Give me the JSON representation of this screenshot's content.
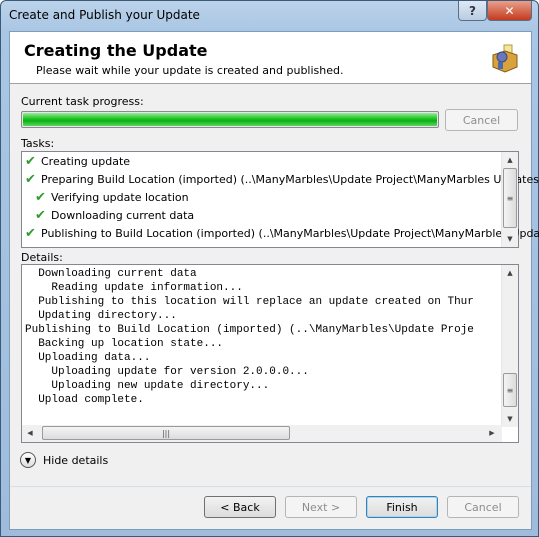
{
  "window": {
    "title": "Create and Publish your Update",
    "help_label": "?",
    "close_label": "✕"
  },
  "header": {
    "title": "Creating the Update",
    "subtitle": "Please wait while your update is created and published.",
    "logo_icon": "package-gear-icon"
  },
  "progress": {
    "label": "Current task progress:",
    "percent": 100,
    "cancel_label": "Cancel",
    "bar_color": "#16c41e"
  },
  "tasks": {
    "label": "Tasks:",
    "items": [
      {
        "text": "Creating update",
        "level": 0,
        "status": "done"
      },
      {
        "text": "Preparing Build Location (imported) (..\\ManyMarbles\\Update Project\\ManyMarbles Updates)",
        "level": 0,
        "status": "done"
      },
      {
        "text": "Verifying update location",
        "level": 1,
        "status": "done"
      },
      {
        "text": "Downloading current data",
        "level": 1,
        "status": "done"
      },
      {
        "text": "Publishing to Build Location (imported) (..\\ManyMarbles\\Update Project\\ManyMarbles Updates)",
        "level": 0,
        "status": "done"
      }
    ]
  },
  "details": {
    "label": "Details:",
    "lines": [
      "  Downloading current data",
      "    Reading update information...",
      "  Publishing to this location will replace an update created on Thur",
      "  Updating directory...",
      "Publishing to Build Location (imported) (..\\ManyMarbles\\Update Proje",
      "  Backing up location state...",
      "  Uploading data...",
      "    Uploading update for version 2.0.0.0...",
      "    Uploading new update directory...",
      "  Upload complete."
    ]
  },
  "toggle": {
    "label": "Hide details"
  },
  "footer": {
    "back_label": "< Back",
    "next_label": "Next >",
    "finish_label": "Finish",
    "cancel_label": "Cancel"
  }
}
